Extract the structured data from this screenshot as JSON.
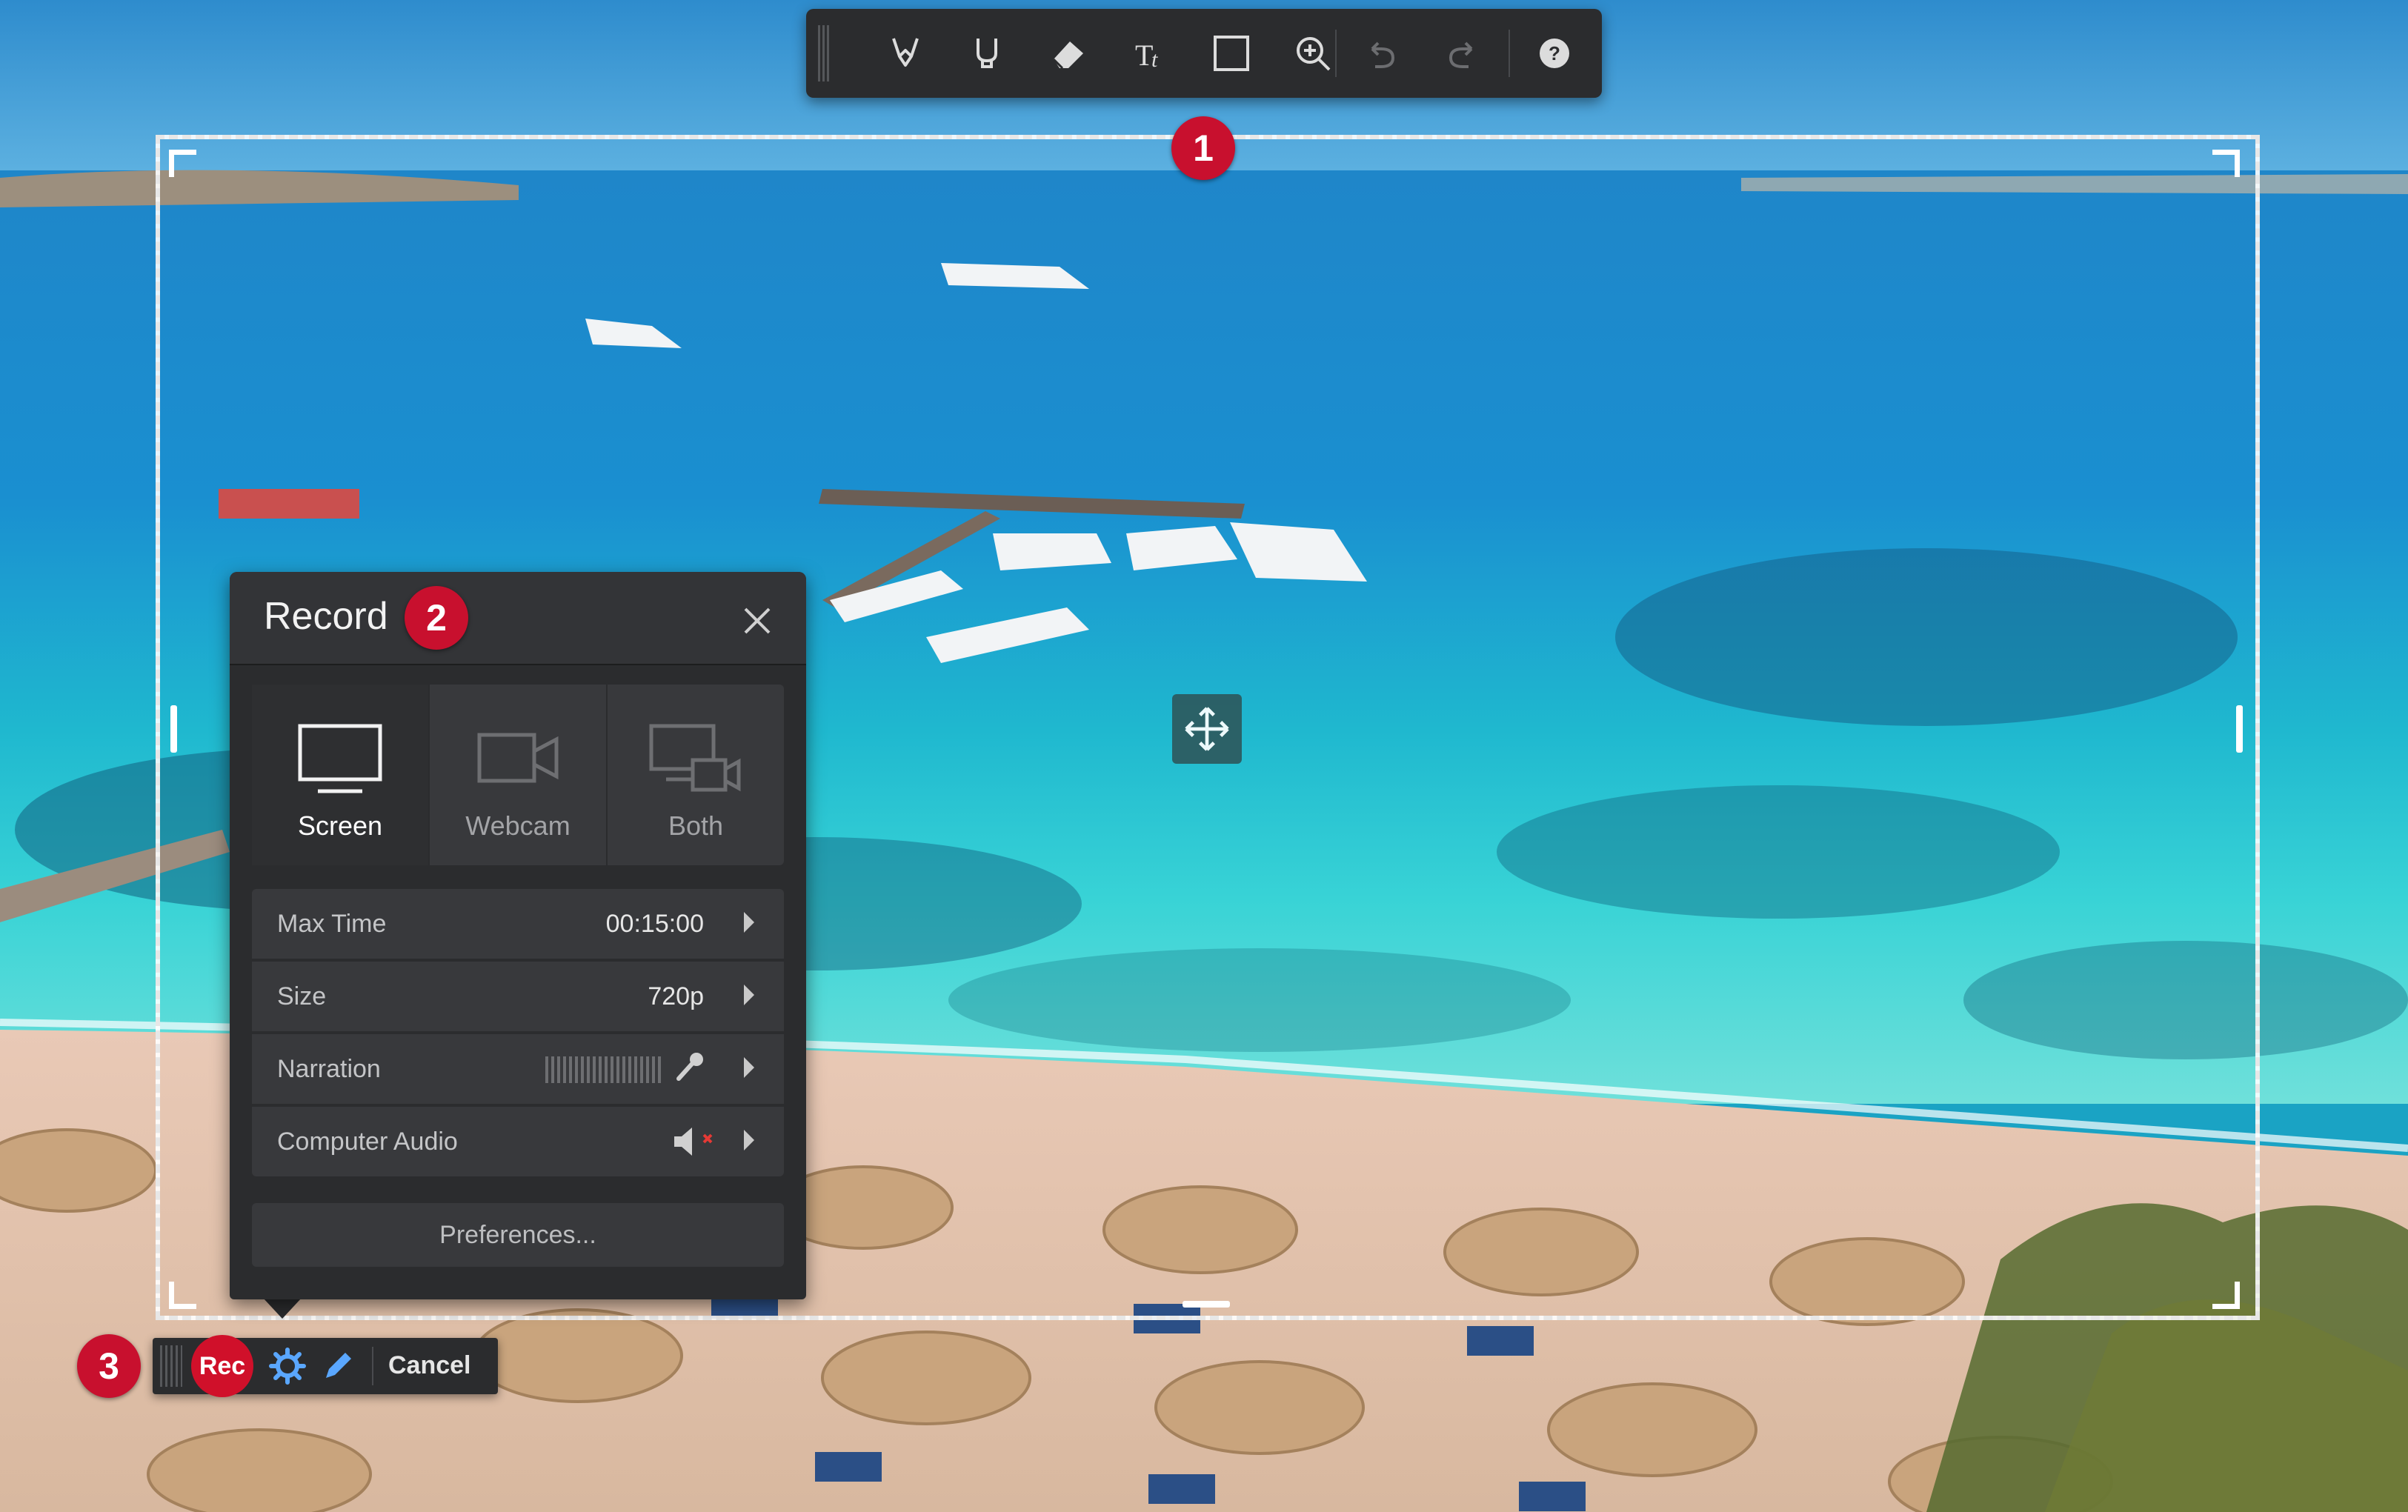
{
  "toolbar": {
    "tools": [
      "highlighter-tool",
      "pen-tool",
      "eraser-tool",
      "text-tool",
      "rectangle-tool",
      "zoom-tool",
      "undo",
      "redo",
      "help"
    ]
  },
  "badges": {
    "one": "1",
    "two": "2",
    "three": "3"
  },
  "panel": {
    "title": "Record",
    "modes": [
      {
        "label": "Screen",
        "active": true
      },
      {
        "label": "Webcam",
        "active": false
      },
      {
        "label": "Both",
        "active": false
      }
    ],
    "max_time": {
      "label": "Max Time",
      "value": "00:15:00"
    },
    "size": {
      "label": "Size",
      "value": "720p"
    },
    "narration": {
      "label": "Narration"
    },
    "computer_audio": {
      "label": "Computer Audio"
    },
    "preferences": "Preferences..."
  },
  "controls": {
    "rec": "Rec",
    "cancel": "Cancel"
  },
  "colors": {
    "accent": "#c8102e",
    "panel": "#2b2c2e",
    "row": "#38393c",
    "pen_blue": "#5aa7ff"
  }
}
